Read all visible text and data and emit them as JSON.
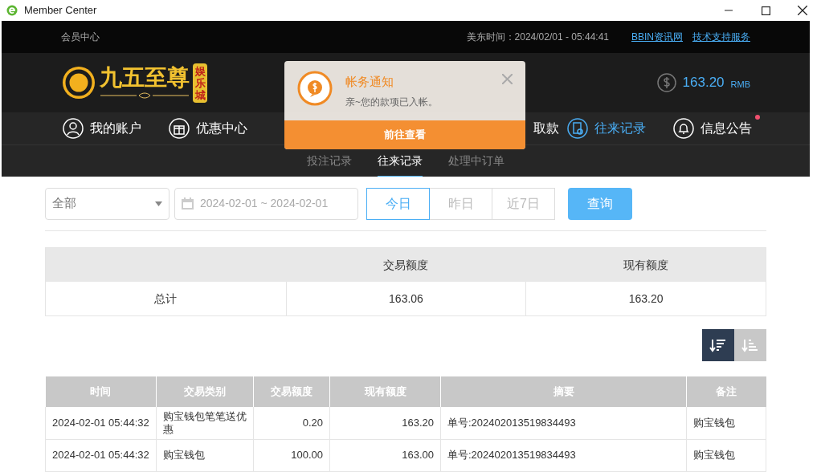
{
  "window": {
    "title": "Member Center"
  },
  "top_bar": {
    "title": "会员中心",
    "time": "美东时间：2024/02/01 - 05:44:41",
    "links": [
      "BBIN资讯网",
      "技术支持服务"
    ]
  },
  "logo": {
    "name": "九五至尊",
    "badge": "娱乐城"
  },
  "balance": {
    "amount": "163.20",
    "currency": "RMB"
  },
  "nav": [
    {
      "label": "我的账户",
      "kind": "user",
      "selected": false,
      "dot": false
    },
    {
      "label": "优惠中心",
      "kind": "gift",
      "selected": false,
      "dot": false
    },
    {
      "label": "取款",
      "kind": "partial",
      "selected": false,
      "dot": false
    },
    {
      "label": "往来记录",
      "kind": "record",
      "selected": true,
      "dot": false
    },
    {
      "label": "信息公告",
      "kind": "bell",
      "selected": false,
      "dot": true
    }
  ],
  "sub_tabs": [
    {
      "label": "投注记录",
      "selected": false
    },
    {
      "label": "往来记录",
      "selected": true
    },
    {
      "label": "处理中订单",
      "selected": false
    }
  ],
  "notification": {
    "title": "帐务通知",
    "message": "亲~您的款项已入帐。",
    "button": "前往查看"
  },
  "filters": {
    "type": "全部",
    "date_range": "2024-02-01 ~ 2024-02-01",
    "quick": [
      {
        "label": "今日",
        "selected": true
      },
      {
        "label": "昨日",
        "selected": false
      },
      {
        "label": "近7日",
        "selected": false
      }
    ],
    "search_button": "查询"
  },
  "summary": {
    "columns": [
      "交易额度",
      "现有额度"
    ],
    "row": [
      "总计",
      "163.06",
      "163.20"
    ]
  },
  "sort_buttons": [
    {
      "kind": "desc",
      "selected": true
    },
    {
      "kind": "asc",
      "selected": false
    }
  ],
  "table": {
    "columns": [
      "时间",
      "交易类别",
      "交易额度",
      "现有额度",
      "摘要",
      "备注"
    ],
    "rows": [
      [
        "2024-02-01 05:44:32",
        "购宝钱包笔笔送优惠",
        "0.20",
        "163.20",
        "单号:202402013519834493",
        "购宝钱包"
      ],
      [
        "2024-02-01 05:44:32",
        "购宝钱包",
        "100.00",
        "163.00",
        "单号:202402013519834493",
        "购宝钱包"
      ]
    ]
  }
}
